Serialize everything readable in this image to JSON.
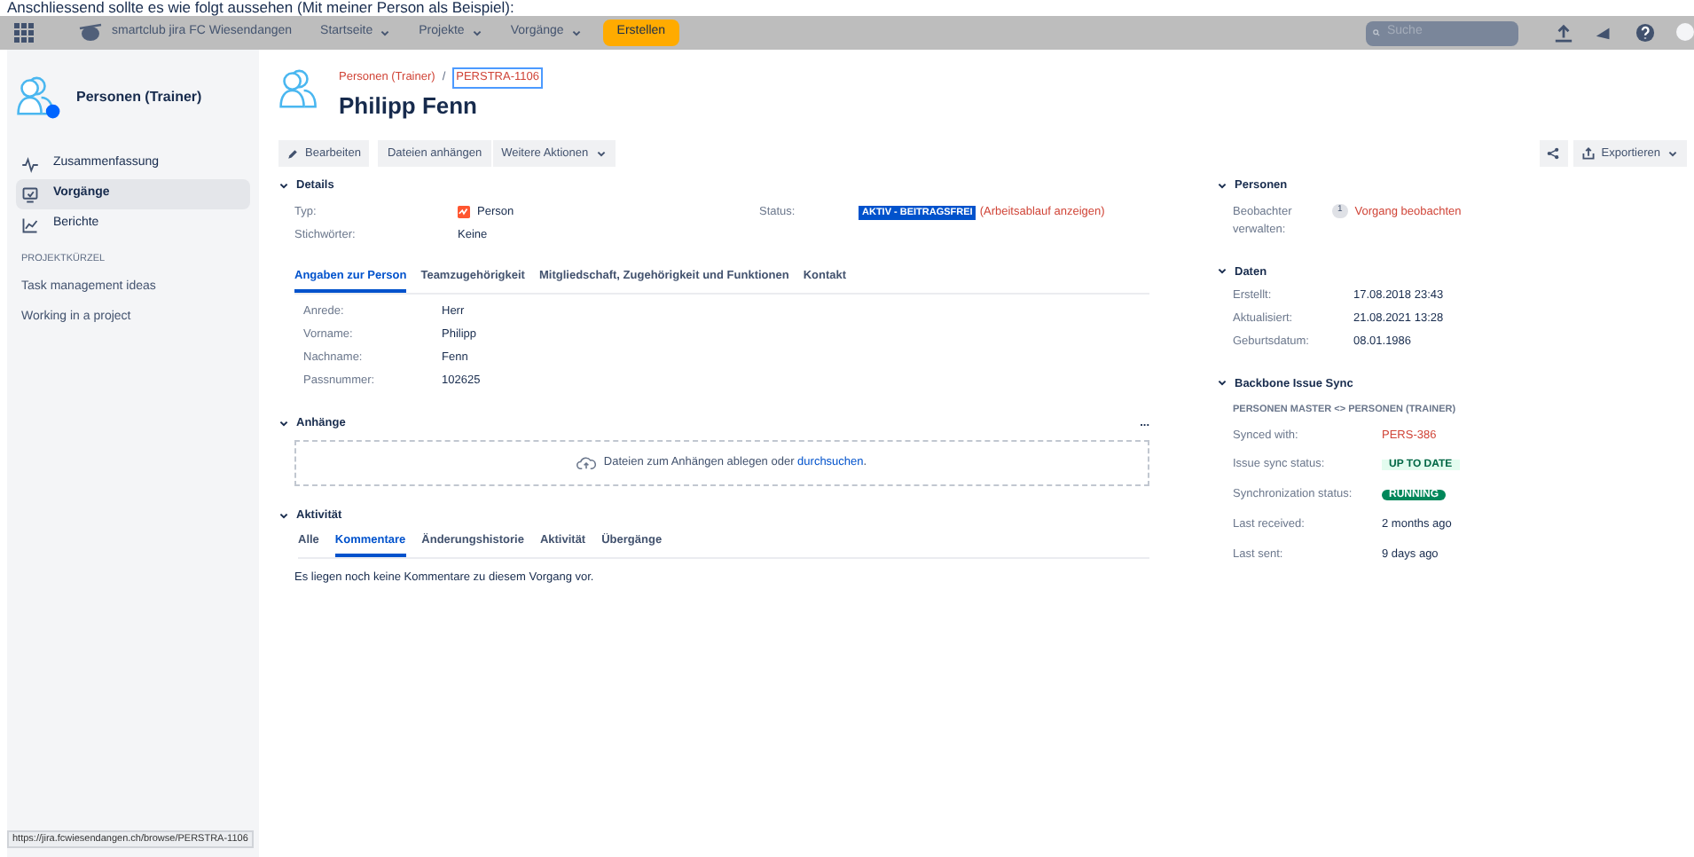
{
  "caption": "Anschliessend sollte es wie folgt aussehen (Mit meiner Person als Beispiel):",
  "header": {
    "app_title": "smartclub jira FC Wiesendangen",
    "nav": [
      "Startseite",
      "Projekte",
      "Vorgänge"
    ],
    "create_button": "Erstellen",
    "search_placeholder": "Suche"
  },
  "sidebar": {
    "project_name": "Personen (Trainer)",
    "items": [
      {
        "label": "Zusammenfassung",
        "selected": false,
        "kind": "pulse"
      },
      {
        "label": "Vorgänge",
        "selected": true,
        "kind": "monitor"
      },
      {
        "label": "Berichte",
        "selected": false,
        "kind": "chart"
      }
    ],
    "section_heading": "PROJEKTKÜRZEL",
    "shortcuts": [
      "Task management ideas",
      "Working in a project"
    ]
  },
  "issue": {
    "breadcrumb_project": "Personen (Trainer)",
    "separator": "/",
    "issue_key": "PERSTRA-1106",
    "title": "Philipp Fenn"
  },
  "actions": [
    "Bearbeiten",
    "Dateien anhängen",
    "Weitere Aktionen"
  ],
  "export_button": "Exportieren",
  "details": {
    "heading": "Details",
    "type_label": "Typ:",
    "type_value": "Person",
    "labels_label": "Stichwörter:",
    "labels_value": "Keine",
    "status_label": "Status:",
    "status_value": "AKTIV - BEITRAGSFREI",
    "workflow_link": "(Arbeitsablauf anzeigen)",
    "tabs": [
      {
        "label": "Angaben zur Person",
        "selected": true
      },
      {
        "label": "Teamzugehörigkeit",
        "selected": false
      },
      {
        "label": "Mitgliedschaft, Zugehörigkeit und Funktionen",
        "selected": false
      },
      {
        "label": "Kontakt",
        "selected": false
      }
    ],
    "fields": [
      {
        "label": "Anrede:",
        "value": "Herr"
      },
      {
        "label": "Vorname:",
        "value": "Philipp"
      },
      {
        "label": "Nachname:",
        "value": "Fenn"
      },
      {
        "label": "Passnummer:",
        "value": "102625"
      }
    ]
  },
  "attachments": {
    "heading": "Anhänge",
    "more": "...",
    "drop_text": "Dateien zum Anhängen ablegen oder ",
    "browse_link": "durchsuchen",
    "drop_end": "."
  },
  "activity": {
    "heading": "Aktivität",
    "tabs": [
      {
        "label": "Alle",
        "selected": false
      },
      {
        "label": "Kommentare",
        "selected": true
      },
      {
        "label": "Änderungshistorie",
        "selected": false
      },
      {
        "label": "Aktivität",
        "selected": false
      },
      {
        "label": "Übergänge",
        "selected": false
      }
    ],
    "empty_message": "Es liegen noch keine Kommentare zu diesem Vorgang vor."
  },
  "people": {
    "heading": "Personen",
    "watchers_label": "Beobachter verwalten:",
    "watch_count": "1",
    "watch_link": "Vorgang beobachten"
  },
  "dates": {
    "heading": "Daten",
    "rows": [
      {
        "label": "Erstellt:",
        "value": "17.08.2018 23:43"
      },
      {
        "label": "Aktualisiert:",
        "value": "21.08.2021 13:28"
      },
      {
        "label": "Geburtsdatum:",
        "value": "08.01.1986"
      }
    ]
  },
  "sync": {
    "heading": "Backbone Issue Sync",
    "subtitle": "PERSONEN MASTER <> PERSONEN (TRAINER)",
    "rows": [
      {
        "label": "Synced with:",
        "value": "PERS-386",
        "kind": "link"
      },
      {
        "label": "Issue sync status:",
        "value": "UP TO DATE",
        "kind": "subtle"
      },
      {
        "label": "Synchronization status:",
        "value": "RUNNING",
        "kind": "bold"
      },
      {
        "label": "Last received:",
        "value": "2 months ago",
        "kind": "text"
      },
      {
        "label": "Last sent:",
        "value": "9 days ago",
        "kind": "text"
      }
    ]
  },
  "status_url": "https://jira.fcwiesendangen.ch/browse/PERSTRA-1106"
}
